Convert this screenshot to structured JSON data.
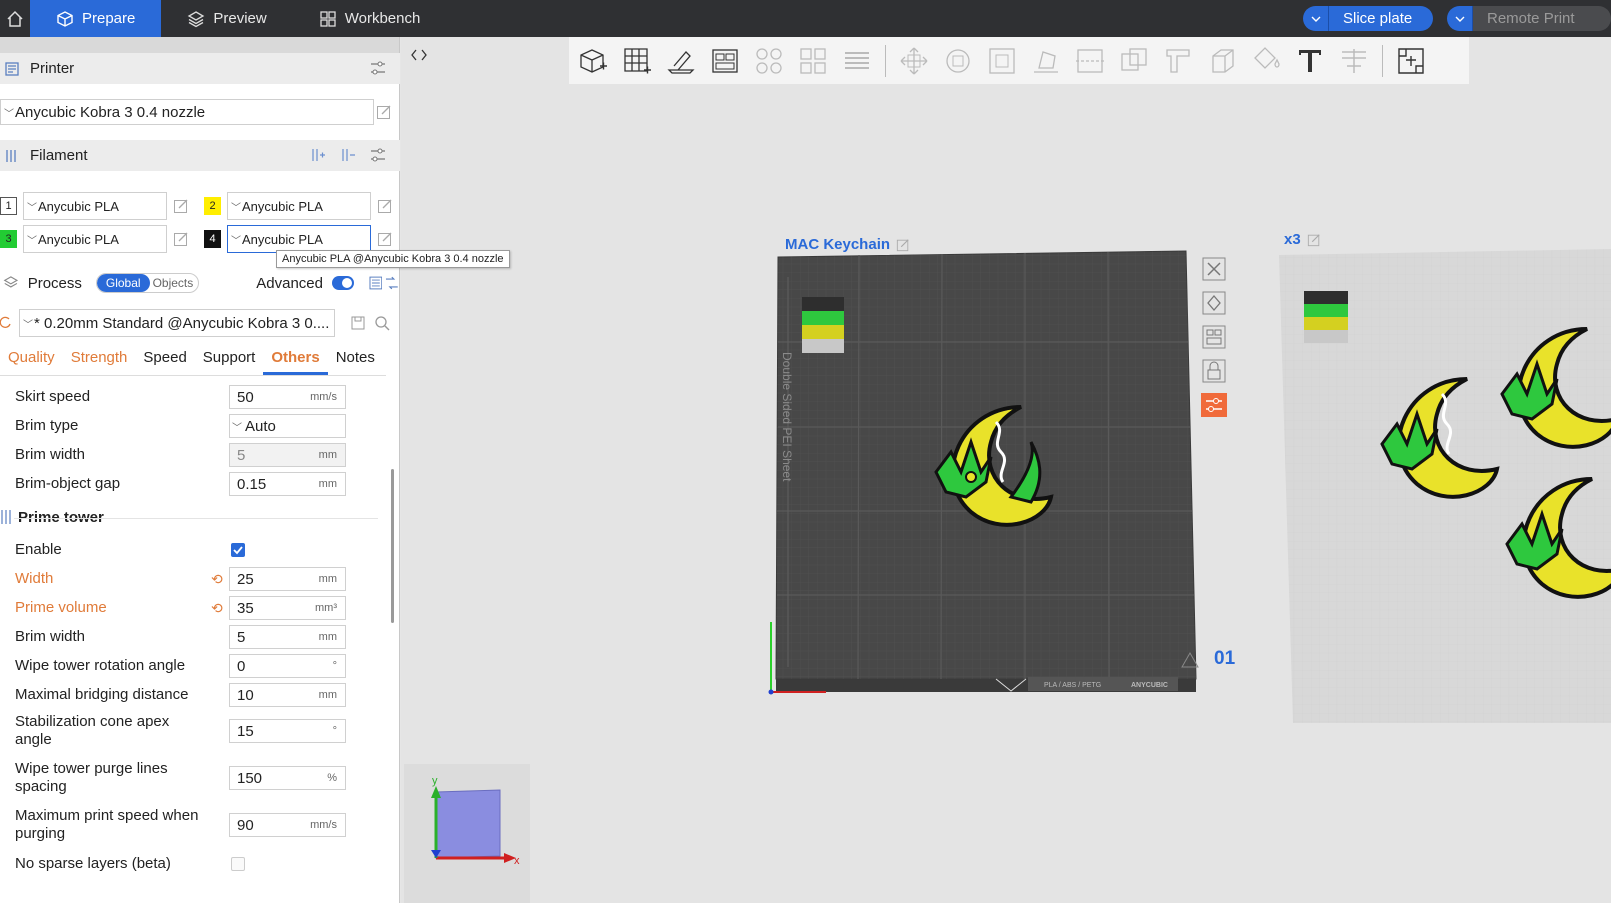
{
  "topbar": {
    "tabs": [
      {
        "label": "Prepare",
        "icon": "cube-icon",
        "active": true
      },
      {
        "label": "Preview",
        "icon": "layers-icon",
        "active": false
      },
      {
        "label": "Workbench",
        "icon": "grid-icon",
        "active": false
      }
    ],
    "slice_label": "Slice plate",
    "remote_label": "Remote Print"
  },
  "printer": {
    "title": "Printer",
    "selected": "Anycubic Kobra 3 0.4 nozzle"
  },
  "filament": {
    "title": "Filament",
    "slots": [
      {
        "num": "1",
        "color": "#ffffff",
        "name": "Anycubic PLA"
      },
      {
        "num": "2",
        "color": "#ffee00",
        "name": "Anycubic PLA"
      },
      {
        "num": "3",
        "color": "#22cc33",
        "name": "Anycubic PLA"
      },
      {
        "num": "4",
        "color": "#111111",
        "name": "Anycubic PLA"
      }
    ],
    "tooltip": "Anycubic PLA @Anycubic Kobra 3 0.4 nozzle"
  },
  "process": {
    "title": "Process",
    "scope_on": "Global",
    "scope_off": "Objects",
    "advanced_label": "Advanced",
    "preset": "* 0.20mm Standard @Anycubic Kobra 3 0...."
  },
  "subtabs": [
    "Quality",
    "Strength",
    "Speed",
    "Support",
    "Others",
    "Notes"
  ],
  "settings": {
    "skirt_speed": {
      "label": "Skirt speed",
      "value": "50",
      "unit": "mm/s"
    },
    "brim_type": {
      "label": "Brim type",
      "value": "Auto"
    },
    "brim_width": {
      "label": "Brim width",
      "value": "5",
      "unit": "mm"
    },
    "brim_gap": {
      "label": "Brim-object gap",
      "value": "0.15",
      "unit": "mm"
    },
    "prime_tower_title": "Prime tower",
    "enable": {
      "label": "Enable",
      "checked": true
    },
    "width": {
      "label": "Width",
      "value": "25",
      "unit": "mm"
    },
    "prime_volume": {
      "label": "Prime volume",
      "value": "35",
      "unit": "mm³"
    },
    "pt_brim_width": {
      "label": "Brim width",
      "value": "5",
      "unit": "mm"
    },
    "rotation": {
      "label": "Wipe tower rotation angle",
      "value": "0",
      "unit": "°"
    },
    "bridging": {
      "label": "Maximal bridging distance",
      "value": "10",
      "unit": "mm"
    },
    "cone_angle": {
      "label_1": "Stabilization cone apex",
      "label_2": "angle",
      "value": "15",
      "unit": "°"
    },
    "purge_spacing": {
      "label_1": "Wipe tower purge lines",
      "label_2": "spacing",
      "value": "150",
      "unit": "%"
    },
    "purge_speed": {
      "label_1": "Maximum print speed when",
      "label_2": "purging",
      "value": "90",
      "unit": "mm/s"
    },
    "no_sparse": {
      "label": "No sparse layers (beta)",
      "checked": false
    }
  },
  "canvas": {
    "plate1_name": "MAC Keychain",
    "plate1_number": "01",
    "plate1_side_text": "Double Sided PEI Sheet",
    "plate1_bed_text_1": "PLA / ABS / PETG",
    "plate1_bed_text_2": "ANYCUBIC",
    "plate2_name": "x3",
    "axis_x": "x",
    "axis_y": "y"
  },
  "colors": {
    "accent": "#2a6ad8",
    "warning": "#e07b39",
    "topbar": "#2f3033",
    "bed": "#4a4a4a"
  }
}
